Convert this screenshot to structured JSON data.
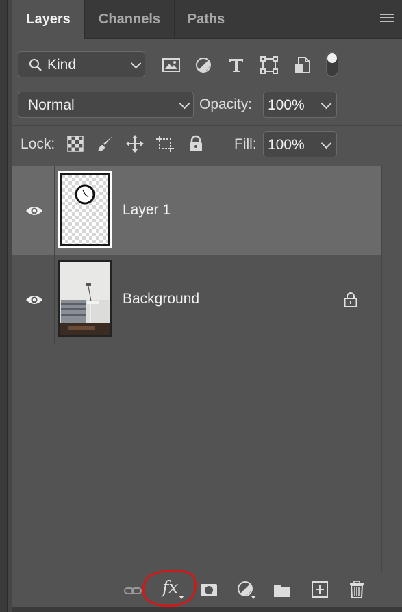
{
  "tabs": [
    {
      "label": "Layers",
      "active": true
    },
    {
      "label": "Channels",
      "active": false
    },
    {
      "label": "Paths",
      "active": false
    }
  ],
  "filter": {
    "kind_label": "Kind",
    "filter_icons": [
      "image-filter-icon",
      "adjustment-filter-icon",
      "type-filter-icon",
      "shape-filter-icon",
      "smart-object-filter-icon"
    ],
    "filter_toggle": "on"
  },
  "blend": {
    "mode": "Normal",
    "opacity_label": "Opacity:",
    "opacity_value": "100%"
  },
  "lock": {
    "label": "Lock:",
    "fill_label": "Fill:",
    "fill_value": "100%",
    "lock_icons": [
      "lock-transparent-pixels-icon",
      "lock-image-pixels-icon",
      "lock-position-icon",
      "lock-artboard-icon",
      "lock-all-icon"
    ]
  },
  "layers": [
    {
      "name": "Layer 1",
      "selected": true,
      "visible": true,
      "locked": false
    },
    {
      "name": "Background",
      "selected": false,
      "visible": true,
      "locked": true
    }
  ],
  "bottom_bar": {
    "fx_label": "fx",
    "icons": [
      "link-layers-icon",
      "fx-icon",
      "add-mask-icon",
      "adjustment-layer-icon",
      "new-group-icon",
      "new-layer-icon",
      "delete-layer-icon"
    ],
    "highlight_color": "#d01a1a"
  },
  "colors": {
    "panel": "#535353",
    "selected_row": "#6a6a6a",
    "tab_bar": "#393939"
  }
}
